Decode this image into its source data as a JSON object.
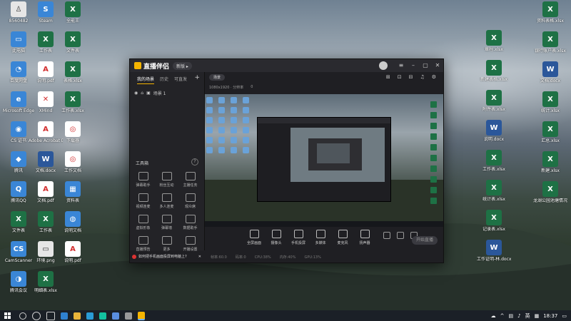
{
  "desktop_left": [
    {
      "label": "8560482",
      "type": "im",
      "glyph": "♙"
    },
    {
      "label": "Steam",
      "type": "ap",
      "glyph": "S"
    },
    {
      "label": "全能王",
      "type": "xl",
      "glyph": "X"
    },
    {
      "label": "此电脑",
      "type": "ap",
      "glyph": "▭"
    },
    {
      "label": "工作表",
      "type": "xl",
      "glyph": "X"
    },
    {
      "label": "文件表",
      "type": "xl",
      "glyph": "X"
    },
    {
      "label": "百度网盘",
      "type": "ap",
      "glyph": "◔"
    },
    {
      "label": "说明.pdf",
      "type": "pdf",
      "glyph": "A"
    },
    {
      "label": "表格.xlsx",
      "type": "xl",
      "glyph": "X"
    },
    {
      "label": "Microsoft Edge",
      "type": "ap",
      "glyph": "e"
    },
    {
      "label": "XMind",
      "type": "pdf",
      "glyph": "✕"
    },
    {
      "label": "工作表.xlsx",
      "type": "xl",
      "glyph": "X"
    },
    {
      "label": "CS 证书",
      "type": "ap",
      "glyph": "◉"
    },
    {
      "label": "Adobe Acrobat DC",
      "type": "pdf",
      "glyph": "A"
    },
    {
      "label": "下载器",
      "type": "pdf",
      "glyph": "◎"
    },
    {
      "label": "腾讯",
      "type": "ap",
      "glyph": "◆"
    },
    {
      "label": "文档.docx",
      "type": "wd",
      "glyph": "W"
    },
    {
      "label": "工作文档",
      "type": "pdf",
      "glyph": "◎"
    },
    {
      "label": "腾讯QQ",
      "type": "ap",
      "glyph": "Q"
    },
    {
      "label": "文档.pdf",
      "type": "pdf",
      "glyph": "A"
    },
    {
      "label": "资料表",
      "type": "ap",
      "glyph": "▦"
    },
    {
      "label": "文件表",
      "type": "xl",
      "glyph": "X"
    },
    {
      "label": "工作表",
      "type": "xl",
      "glyph": "X"
    },
    {
      "label": "说明文档",
      "type": "ap",
      "glyph": "◍"
    },
    {
      "label": "CamScanner",
      "type": "ap",
      "glyph": "CS"
    },
    {
      "label": "环境.png",
      "type": "im",
      "glyph": "▭"
    },
    {
      "label": "说明.pdf",
      "type": "pdf",
      "glyph": "A"
    },
    {
      "label": "腾讯会议",
      "type": "ap",
      "glyph": "◑"
    },
    {
      "label": "明细表.xlsx",
      "type": "xl",
      "glyph": "X"
    }
  ],
  "desktop_right": [
    {
      "label": "章程.xlsx",
      "type": "xl",
      "glyph": "X"
    },
    {
      "label": "资料表格.xlsx",
      "type": "xl",
      "glyph": "X"
    },
    {
      "label": "新建表格.xlsx",
      "type": "xl",
      "glyph": "X"
    },
    {
      "label": "银行账户表.xlsx",
      "type": "xl",
      "glyph": "X"
    },
    {
      "label": "附件表.xlsx",
      "type": "xl",
      "glyph": "X"
    },
    {
      "label": "文档.docx",
      "type": "wd",
      "glyph": "W"
    },
    {
      "label": "说明.docx",
      "type": "wd",
      "glyph": "W"
    },
    {
      "label": "统计.xlsx",
      "type": "xl",
      "glyph": "X"
    },
    {
      "label": "工作表.xlsx",
      "type": "xl",
      "glyph": "X"
    },
    {
      "label": "汇总.xlsx",
      "type": "xl",
      "glyph": "X"
    },
    {
      "label": "统计表.xlsx",
      "type": "xl",
      "glyph": "X"
    },
    {
      "label": "新建.xlsx",
      "type": "xl",
      "glyph": "X"
    },
    {
      "label": "记录表.xlsx",
      "type": "xl",
      "glyph": "X"
    },
    {
      "label": "龙湖公园池塘情况统计表",
      "type": "xl",
      "glyph": "X"
    },
    {
      "label": "工作证明-林.docx",
      "type": "wd",
      "glyph": "W"
    }
  ],
  "app": {
    "name": "直播伴侣",
    "version_badge": "新版 ▸",
    "tabs": [
      "我的场景",
      "历史",
      "可直发"
    ],
    "add_tab": "+",
    "scene_label": "场景 1",
    "tools_title": "工具箱",
    "tools_help": "?",
    "tools": [
      {
        "label": "弹幕助手"
      },
      {
        "label": "粉丝互动"
      },
      {
        "label": "主播任务"
      },
      {
        "label": "视频连麦"
      },
      {
        "label": "多人连麦"
      },
      {
        "label": "观众席"
      },
      {
        "label": "虚拟形象"
      },
      {
        "label": "弹幕墙"
      },
      {
        "label": "数据助手"
      },
      {
        "label": "直播预告"
      },
      {
        "label": "更多"
      },
      {
        "label": "开播设置"
      }
    ],
    "notice": "如何把手机画面投屏到电脑上?",
    "scene_chip": "场景",
    "preview_info": [
      "1080x1920 · 分辨率",
      "0"
    ],
    "controls": [
      {
        "label": "全屏画面"
      },
      {
        "label": "摄像头"
      },
      {
        "label": "手机投屏"
      },
      {
        "label": "多媒体"
      },
      {
        "label": "麦克风"
      },
      {
        "label": "扬声器"
      }
    ],
    "start_button": "开始直播",
    "status": [
      "帧率:60.0",
      "码率:0",
      "CPU:38%",
      "内存:40%",
      "GPU:13%"
    ]
  },
  "taskbar": {
    "time": "18:37",
    "ime": "英"
  }
}
